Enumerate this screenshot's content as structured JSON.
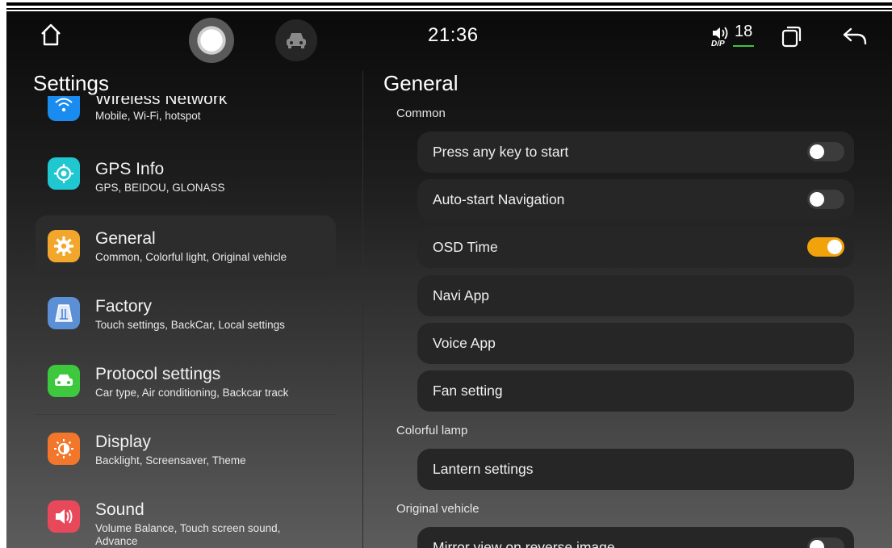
{
  "status_bar": {
    "time": "21:36",
    "dsp_label": "D/P",
    "volume": "18",
    "icons": [
      "home-icon",
      "assistant-button",
      "car-icon",
      "volume-icon",
      "recents-icon",
      "back-icon"
    ]
  },
  "left_panel": {
    "title": "Settings",
    "items": [
      {
        "name": "wireless-network",
        "title": "Wireless Network",
        "subtitle": "Mobile, Wi-Fi, hotspot",
        "icon": "wifi-icon",
        "color": "#1a8cf0"
      },
      {
        "name": "gps-info",
        "title": "GPS Info",
        "subtitle": "GPS, BEIDOU, GLONASS",
        "icon": "gps-icon",
        "color": "#1fc7d1"
      },
      {
        "name": "general",
        "title": "General",
        "subtitle": "Common, Colorful light, Original vehicle",
        "icon": "gear-icon",
        "color": "#f2a72c",
        "selected": true
      },
      {
        "name": "factory",
        "title": "Factory",
        "subtitle": "Touch settings, BackCar, Local settings",
        "icon": "factory-icon",
        "color": "#5b8fd6"
      },
      {
        "name": "protocol-settings",
        "title": "Protocol settings",
        "subtitle": "Car type, Air conditioning, Backcar track",
        "icon": "car-icon",
        "color": "#3ec83e"
      },
      {
        "name": "display",
        "title": "Display",
        "subtitle": "Backlight, Screensaver, Theme",
        "icon": "brightness-icon",
        "color": "#f2772a"
      },
      {
        "name": "sound",
        "title": "Sound",
        "subtitle": "Volume Balance, Touch screen sound, Advance",
        "icon": "speaker-icon",
        "color": "#e8495a"
      }
    ]
  },
  "right_panel": {
    "title": "General",
    "sections": [
      {
        "label": "Common",
        "rows": [
          {
            "label": "Press any key to start",
            "toggle": "off"
          },
          {
            "label": "Auto-start Navigation",
            "toggle": "off"
          },
          {
            "label": "OSD Time",
            "toggle": "on"
          },
          {
            "label": "Navi App"
          },
          {
            "label": "Voice App"
          },
          {
            "label": "Fan setting"
          }
        ]
      },
      {
        "label": "Colorful lamp",
        "rows": [
          {
            "label": "Lantern settings"
          }
        ]
      },
      {
        "label": "Original vehicle",
        "rows": [
          {
            "label": "Mirror view on reverse image",
            "toggle": "off"
          }
        ]
      }
    ]
  },
  "colors": {
    "toggle_on": "#f2a30b",
    "toggle_off": "#3c3c3c",
    "row_background": "#262626",
    "selected_item": "#2c2c2c"
  }
}
